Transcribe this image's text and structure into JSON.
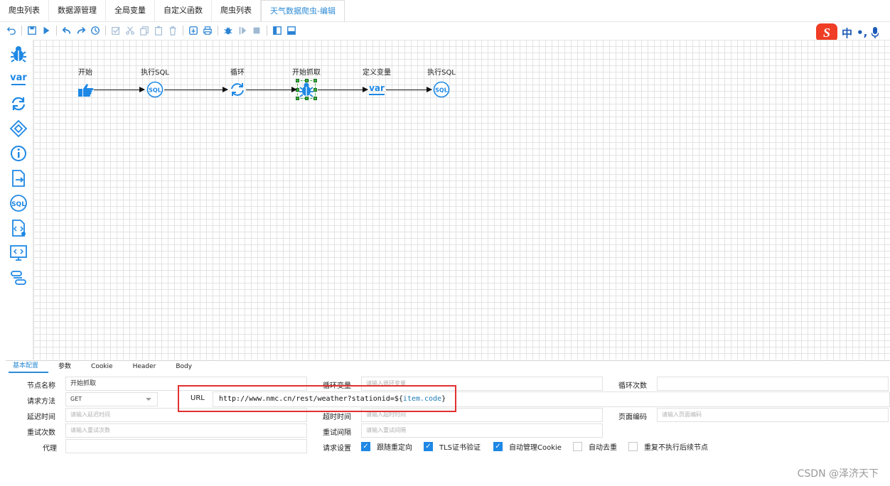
{
  "tabs": [
    {
      "label": "爬虫列表"
    },
    {
      "label": "数据源管理"
    },
    {
      "label": "全局变量"
    },
    {
      "label": "自定义函数"
    },
    {
      "label": "爬虫列表"
    },
    {
      "label": "天气数据爬虫-编辑",
      "active": true
    }
  ],
  "ime": {
    "logo": "S",
    "mode": "中",
    "punct": "•,"
  },
  "flow": {
    "nodes": [
      {
        "label": "开始",
        "icon": "hand-pointer-icon"
      },
      {
        "label": "执行SQL",
        "icon": "sql-icon"
      },
      {
        "label": "循环",
        "icon": "loop-icon"
      },
      {
        "label": "开始抓取",
        "icon": "spider-icon",
        "selected": true
      },
      {
        "label": "定义变量",
        "icon": "var-icon"
      },
      {
        "label": "执行SQL",
        "icon": "sql-icon"
      }
    ]
  },
  "palette": {
    "var_label": "var",
    "sql_label": "SQL"
  },
  "bottom_tabs": [
    {
      "label": "基本配置",
      "active": true
    },
    {
      "label": "参数"
    },
    {
      "label": "Cookie"
    },
    {
      "label": "Header"
    },
    {
      "label": "Body"
    }
  ],
  "form": {
    "node_name": {
      "label": "节点名称",
      "value": "开始抓取"
    },
    "loop_var": {
      "label": "循环变量",
      "placeholder": "请输入循环变量"
    },
    "loop_count": {
      "label": "循环次数",
      "value": ""
    },
    "method": {
      "label": "请求方法",
      "value": "GET"
    },
    "url": {
      "label": "URL",
      "prefix": "http://www.nmc.cn/rest/weather?stationid=${",
      "var": "item.code",
      "suffix": "}"
    },
    "delay": {
      "label": "延迟时间",
      "placeholder": "请输入延迟时间"
    },
    "timeout": {
      "label": "超时时间",
      "placeholder": "请输入超时时间"
    },
    "encoding": {
      "label": "页面编码",
      "placeholder": "请输入页面编码"
    },
    "retry_count": {
      "label": "重试次数",
      "placeholder": "请输入重试次数"
    },
    "retry_interval": {
      "label": "重试间隔",
      "placeholder": "请输入重试间隔"
    },
    "proxy": {
      "label": "代理",
      "value": ""
    },
    "request_settings": {
      "label": "请求设置",
      "options": [
        {
          "label": "跟随重定向",
          "checked": true
        },
        {
          "label": "TLS证书验证",
          "checked": true
        },
        {
          "label": "自动管理Cookie",
          "checked": true
        },
        {
          "label": "自动去重",
          "checked": false
        },
        {
          "label": "重复不执行后续节点",
          "checked": false
        }
      ]
    }
  },
  "watermark": "CSDN @泽济天下",
  "colors": {
    "accent": "#1e88e5",
    "highlight": "#e23030",
    "grid": "#e3e3e3"
  }
}
